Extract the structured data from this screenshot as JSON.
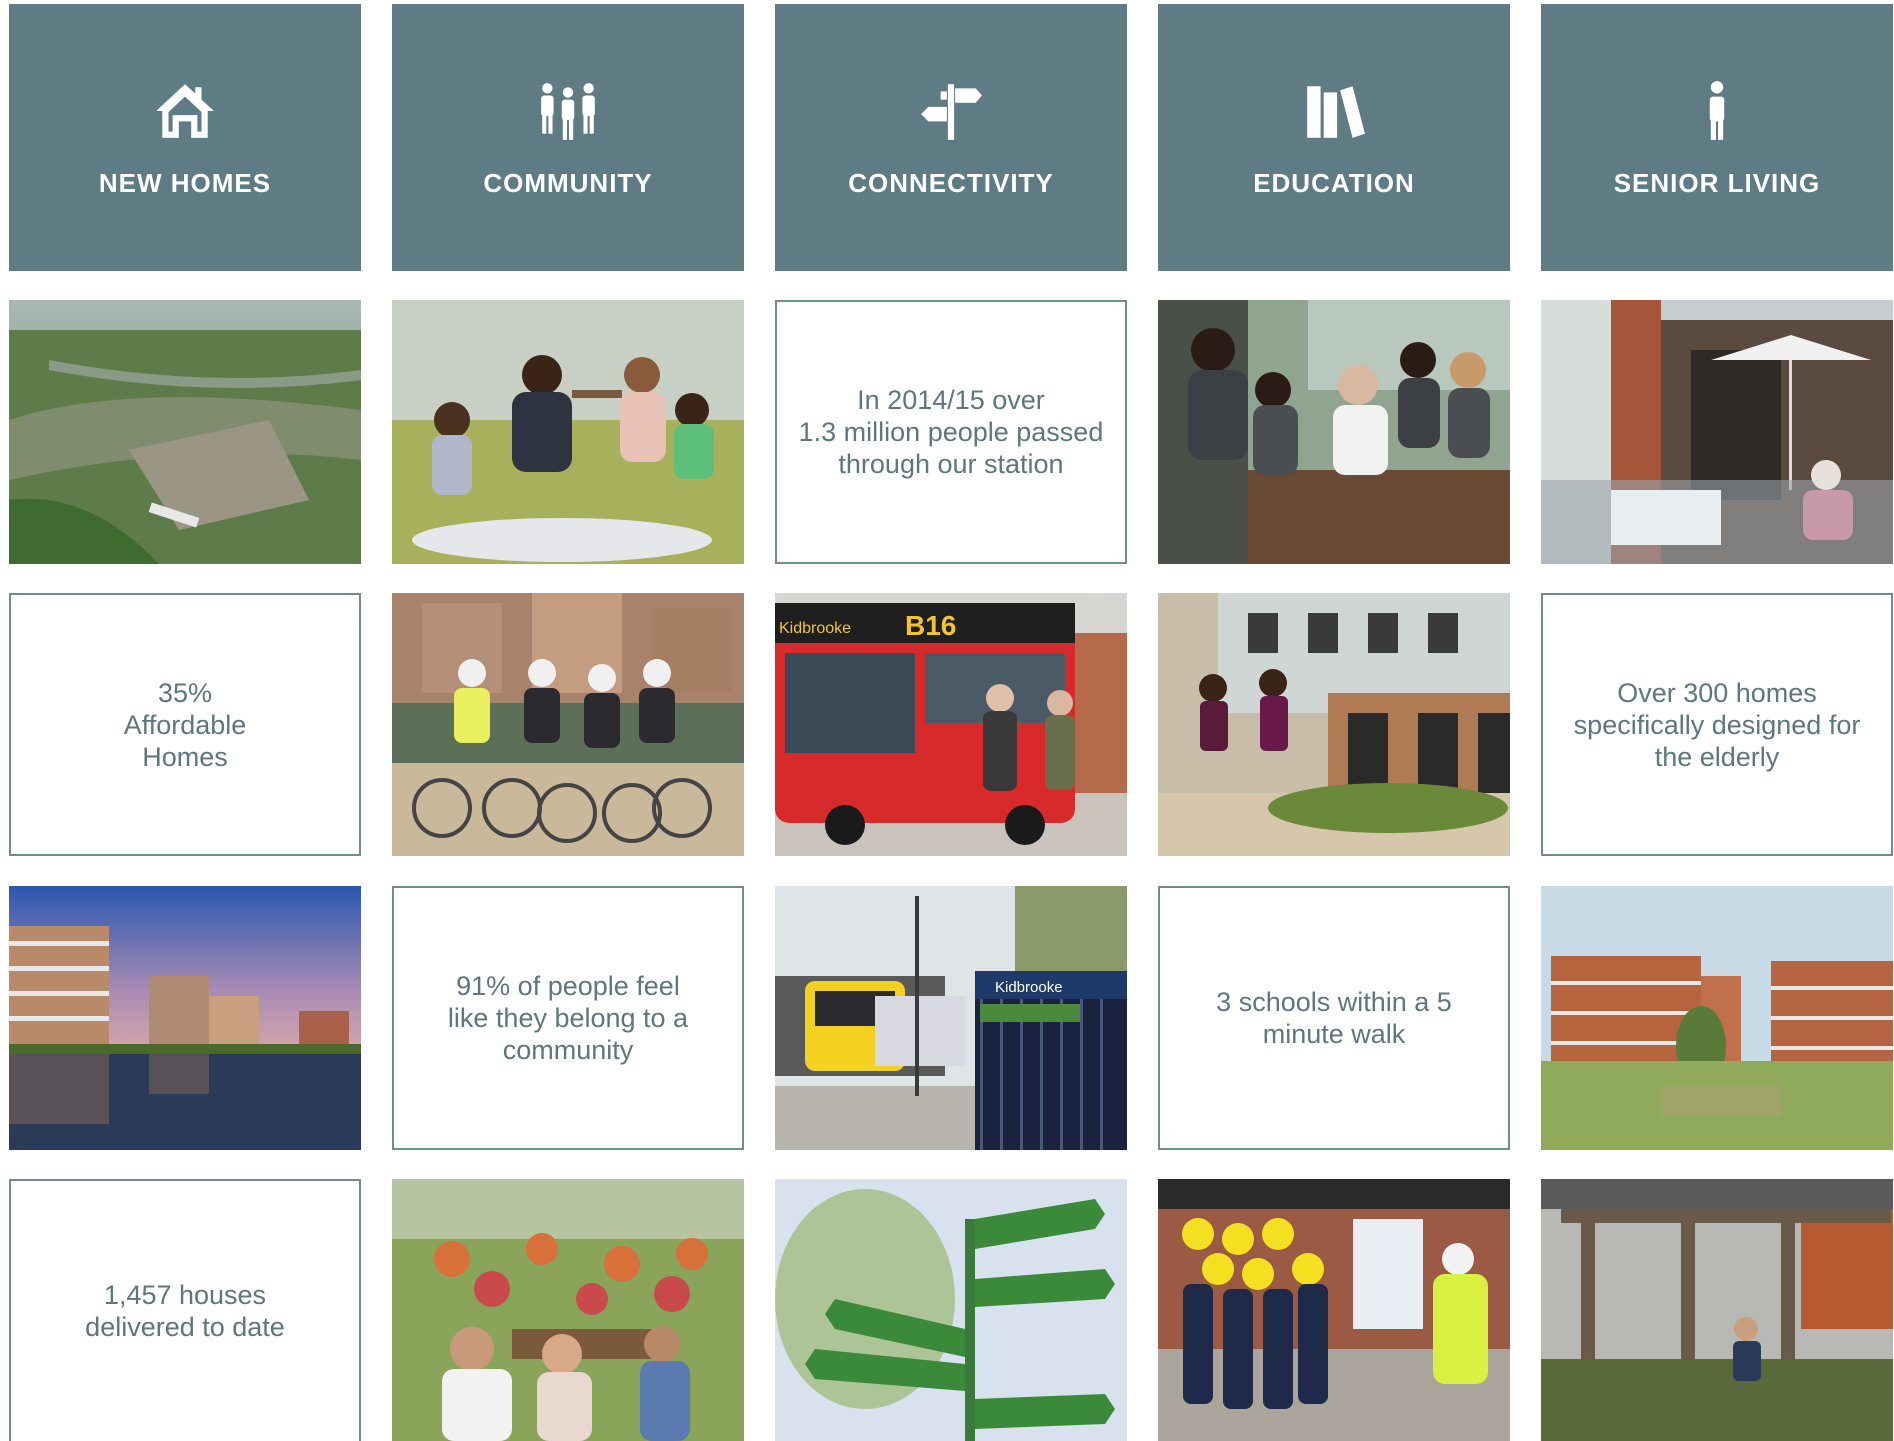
{
  "columns": [
    {
      "header": "NEW HOMES",
      "icon": "house-icon"
    },
    {
      "header": "COMMUNITY",
      "icon": "people-group-icon"
    },
    {
      "header": "CONNECTIVITY",
      "icon": "signpost-icon"
    },
    {
      "header": "EDUCATION",
      "icon": "books-icon"
    },
    {
      "header": "SENIOR LIVING",
      "icon": "person-icon"
    }
  ],
  "stats": {
    "connectivity_station": "In 2014/15 over\n1.3 million people passed\nthrough our station",
    "affordable_homes": "35%\nAffordable\nHomes",
    "elderly_homes": "Over 300 homes\nspecifically designed for\nthe elderly",
    "belong_community": "91% of people feel\nlike they belong to a\ncommunity",
    "schools_walk": "3 schools within a 5\nminute walk",
    "houses_delivered": "1,457 houses\ndelivered to date"
  },
  "photo_text": {
    "bus_route": "B16",
    "bus_destination": "Kidbrooke",
    "station_sign": "Kidbrooke"
  },
  "colors": {
    "header_bg": "#5f7b84",
    "stat_text": "#5b7780",
    "stat_border": "#6f8b93"
  }
}
